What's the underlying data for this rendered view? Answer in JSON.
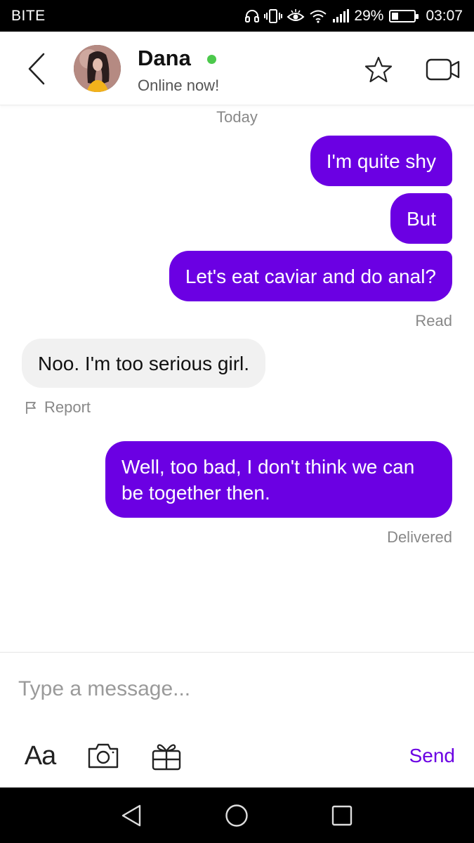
{
  "status_bar": {
    "carrier": "BITE",
    "battery_text": "29%",
    "battery_level": 0.29,
    "time": "03:07",
    "icons": [
      "headphones-icon",
      "vibrate-icon",
      "eye-icon",
      "wifi-icon",
      "signal-icon",
      "battery-icon"
    ]
  },
  "header": {
    "contact_name": "Dana",
    "status": "Online now!",
    "online_color": "#4cc94c",
    "icons": [
      "back-arrow-icon",
      "avatar",
      "star-icon",
      "video-call-icon"
    ]
  },
  "chat": {
    "date_separator": "Today",
    "messages": [
      {
        "direction": "out",
        "text": "I'm quite shy"
      },
      {
        "direction": "out",
        "text": "But"
      },
      {
        "direction": "out",
        "text": "Let's eat caviar and do anal?"
      },
      {
        "direction": "in",
        "text": "Noo. I'm too serious girl."
      },
      {
        "direction": "out",
        "text": "Well, too bad, I don't think we can be together then."
      }
    ],
    "receipt_read": "Read",
    "receipt_delivered": "Delivered",
    "report_label": "Report"
  },
  "composer": {
    "placeholder": "Type a message...",
    "value": "",
    "format_label": "Aa",
    "send_label": "Send",
    "icons": [
      "text-format-icon",
      "camera-icon",
      "gift-icon"
    ]
  },
  "nav_bar": {
    "icons": [
      "nav-back-icon",
      "nav-home-icon",
      "nav-recents-icon"
    ]
  },
  "colors": {
    "accent": "#6b00e3",
    "incoming_bubble": "#f1f1f1",
    "online": "#4cc94c"
  }
}
